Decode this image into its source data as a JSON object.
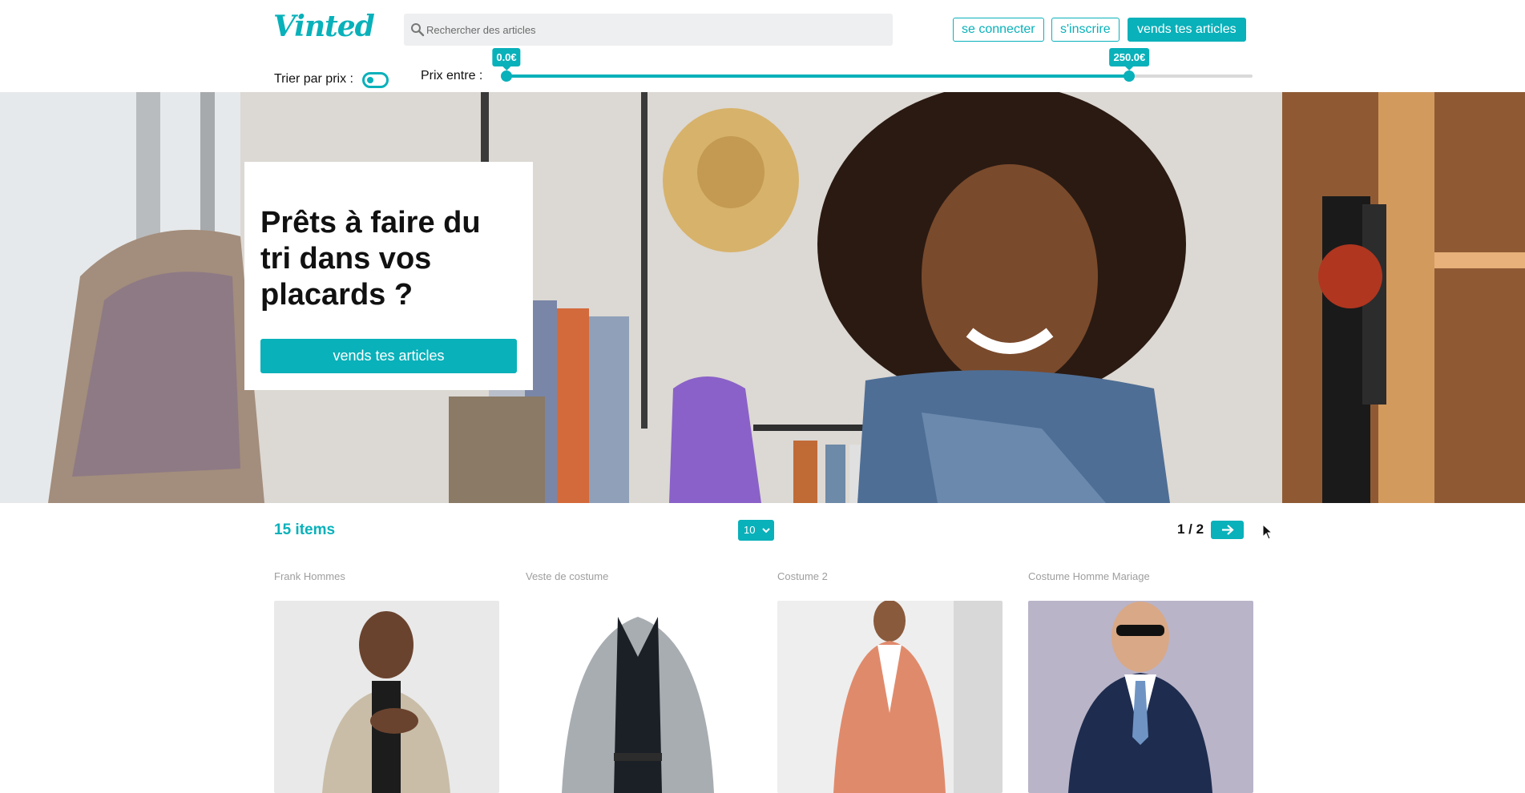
{
  "header": {
    "logo": "Vinted",
    "search_placeholder": "Rechercher des articles",
    "login_label": "se connecter",
    "signup_label": "s'inscrire",
    "sell_label": "vends tes articles"
  },
  "filters": {
    "sort_label": "Trier par prix :",
    "price_label": "Prix entre :",
    "price_min": "0.0€",
    "price_max": "250.0€",
    "range_min_fraction": 0.0,
    "range_max_fraction": 0.835
  },
  "hero": {
    "title": "Prêts à faire du tri dans vos placards ?",
    "button_label": "vends tes articles"
  },
  "results": {
    "count_label": "15 items",
    "per_page": "10",
    "page_indicator": "1 / 2"
  },
  "products": [
    {
      "name": "Frank Hommes"
    },
    {
      "name": "Veste de costume"
    },
    {
      "name": "Costume 2"
    },
    {
      "name": "Costume Homme Mariage"
    }
  ],
  "colors": {
    "accent": "#09b1ba"
  }
}
